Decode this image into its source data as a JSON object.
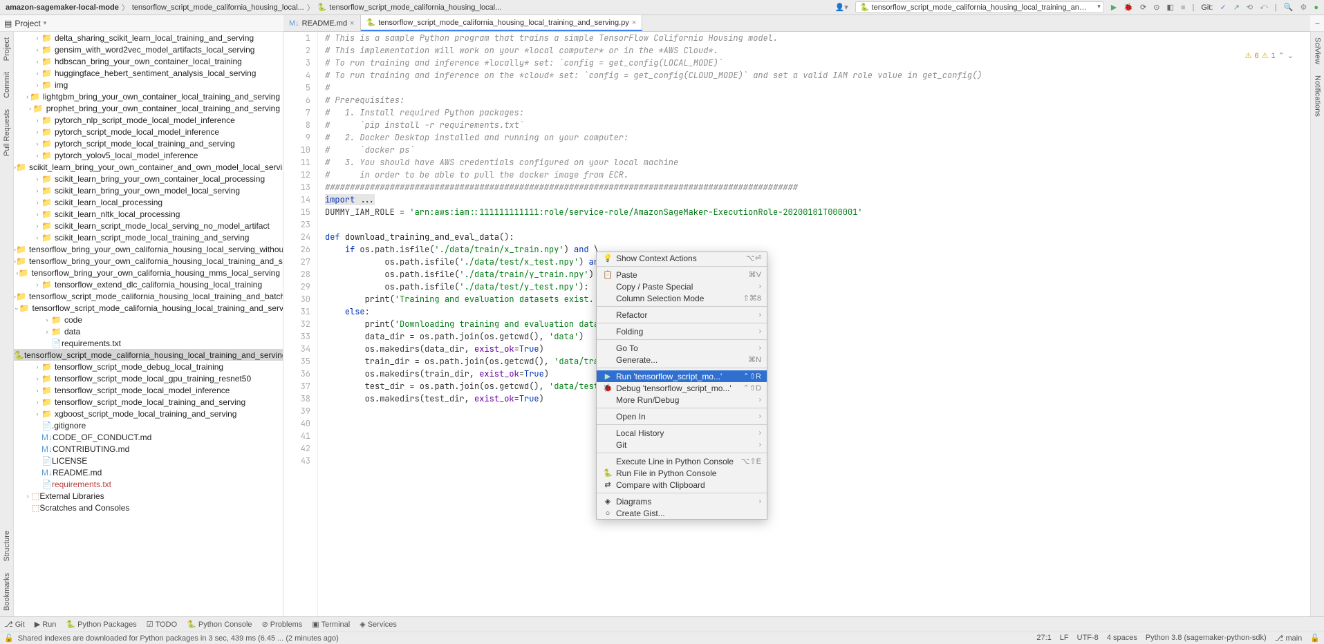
{
  "breadcrumbs": {
    "p0": "amazon-sagemaker-local-mode",
    "p1": "tensorflow_script_mode_california_housing_local...",
    "p2": "tensorflow_script_mode_california_housing_local...",
    "run_config": "tensorflow_script_mode_california_housing_local_training_and_serving",
    "git_label": "Git:"
  },
  "toolbar": {
    "project_label": "Project"
  },
  "left_tools": [
    "Project",
    "Commit",
    "Pull Requests",
    "Structure",
    "Bookmarks"
  ],
  "right_tools": [
    "SciView",
    "Notifications"
  ],
  "tree": [
    {
      "ind": 2,
      "arrow": "›",
      "kind": "folder",
      "label": "delta_sharing_scikit_learn_local_training_and_serving"
    },
    {
      "ind": 2,
      "arrow": "›",
      "kind": "folder",
      "label": "gensim_with_word2vec_model_artifacts_local_serving"
    },
    {
      "ind": 2,
      "arrow": "›",
      "kind": "folder",
      "label": "hdbscan_bring_your_own_container_local_training"
    },
    {
      "ind": 2,
      "arrow": "›",
      "kind": "folder",
      "label": "huggingface_hebert_sentiment_analysis_local_serving"
    },
    {
      "ind": 2,
      "arrow": "›",
      "kind": "folder",
      "label": "img"
    },
    {
      "ind": 2,
      "arrow": "›",
      "kind": "folder",
      "label": "lightgbm_bring_your_own_container_local_training_and_serving"
    },
    {
      "ind": 2,
      "arrow": "›",
      "kind": "folder",
      "label": "prophet_bring_your_own_container_local_training_and_serving"
    },
    {
      "ind": 2,
      "arrow": "›",
      "kind": "folder",
      "label": "pytorch_nlp_script_mode_local_model_inference"
    },
    {
      "ind": 2,
      "arrow": "›",
      "kind": "folder",
      "label": "pytorch_script_mode_local_model_inference"
    },
    {
      "ind": 2,
      "arrow": "›",
      "kind": "folder",
      "label": "pytorch_script_mode_local_training_and_serving"
    },
    {
      "ind": 2,
      "arrow": "›",
      "kind": "folder",
      "label": "pytorch_yolov5_local_model_inference"
    },
    {
      "ind": 2,
      "arrow": "›",
      "kind": "folder",
      "label": "scikit_learn_bring_your_own_container_and_own_model_local_serving"
    },
    {
      "ind": 2,
      "arrow": "›",
      "kind": "folder",
      "label": "scikit_learn_bring_your_own_container_local_processing"
    },
    {
      "ind": 2,
      "arrow": "›",
      "kind": "folder",
      "label": "scikit_learn_bring_your_own_model_local_serving"
    },
    {
      "ind": 2,
      "arrow": "›",
      "kind": "folder",
      "label": "scikit_learn_local_processing"
    },
    {
      "ind": 2,
      "arrow": "›",
      "kind": "folder",
      "label": "scikit_learn_nltk_local_processing"
    },
    {
      "ind": 2,
      "arrow": "›",
      "kind": "folder",
      "label": "scikit_learn_script_mode_local_serving_no_model_artifact"
    },
    {
      "ind": 2,
      "arrow": "›",
      "kind": "folder",
      "label": "scikit_learn_script_mode_local_training_and_serving"
    },
    {
      "ind": 2,
      "arrow": "›",
      "kind": "folder",
      "label": "tensorflow_bring_your_own_california_housing_local_serving_without_tfs"
    },
    {
      "ind": 2,
      "arrow": "›",
      "kind": "folder",
      "label": "tensorflow_bring_your_own_california_housing_local_training_and_serving"
    },
    {
      "ind": 2,
      "arrow": "›",
      "kind": "folder",
      "label": "tensorflow_bring_your_own_california_housing_mms_local_serving"
    },
    {
      "ind": 2,
      "arrow": "›",
      "kind": "folder",
      "label": "tensorflow_extend_dlc_california_housing_local_training"
    },
    {
      "ind": 2,
      "arrow": "›",
      "kind": "folder",
      "label": "tensorflow_script_mode_california_housing_local_training_and_batch_transform"
    },
    {
      "ind": 2,
      "arrow": "⌄",
      "kind": "folder",
      "label": "tensorflow_script_mode_california_housing_local_training_and_serving"
    },
    {
      "ind": 3,
      "arrow": "›",
      "kind": "folder",
      "label": "code"
    },
    {
      "ind": 3,
      "arrow": "›",
      "kind": "folder",
      "label": "data"
    },
    {
      "ind": 3,
      "arrow": "",
      "kind": "file",
      "label": "requirements.txt"
    },
    {
      "ind": 3,
      "arrow": "",
      "kind": "pyfile",
      "label": "tensorflow_script_mode_california_housing_local_training_and_serving.py",
      "selected": true
    },
    {
      "ind": 2,
      "arrow": "›",
      "kind": "folder",
      "label": "tensorflow_script_mode_debug_local_training"
    },
    {
      "ind": 2,
      "arrow": "›",
      "kind": "folder",
      "label": "tensorflow_script_mode_local_gpu_training_resnet50"
    },
    {
      "ind": 2,
      "arrow": "›",
      "kind": "folder",
      "label": "tensorflow_script_mode_local_model_inference"
    },
    {
      "ind": 2,
      "arrow": "›",
      "kind": "folder",
      "label": "tensorflow_script_mode_local_training_and_serving"
    },
    {
      "ind": 2,
      "arrow": "›",
      "kind": "folder",
      "label": "xgboost_script_mode_local_training_and_serving"
    },
    {
      "ind": 2,
      "arrow": "",
      "kind": "file",
      "label": ".gitignore"
    },
    {
      "ind": 2,
      "arrow": "",
      "kind": "mdfile",
      "label": "CODE_OF_CONDUCT.md"
    },
    {
      "ind": 2,
      "arrow": "",
      "kind": "mdfile",
      "label": "CONTRIBUTING.md"
    },
    {
      "ind": 2,
      "arrow": "",
      "kind": "file",
      "label": "LICENSE"
    },
    {
      "ind": 2,
      "arrow": "",
      "kind": "mdfile",
      "label": "README.md"
    },
    {
      "ind": 2,
      "arrow": "",
      "kind": "file",
      "label": "requirements.txt",
      "red": true
    },
    {
      "ind": 1,
      "arrow": "›",
      "kind": "lib",
      "label": "External Libraries"
    },
    {
      "ind": 1,
      "arrow": "",
      "kind": "scratch",
      "label": "Scratches and Consoles"
    }
  ],
  "tabs": [
    {
      "icon": "md",
      "label": "README.md",
      "active": false
    },
    {
      "icon": "py",
      "label": "tensorflow_script_mode_california_housing_local_training_and_serving.py",
      "active": true
    }
  ],
  "inspections": {
    "warn_count": "6",
    "weak_count": "1"
  },
  "code": {
    "lines": [
      {
        "n": 1,
        "cls": "c-comment",
        "t": "# This is a sample Python program that trains a simple TensorFlow California Housing model."
      },
      {
        "n": 2,
        "cls": "c-comment",
        "t": "# This implementation will work on your *local computer* or in the *AWS Cloud*."
      },
      {
        "n": 3,
        "cls": "c-comment",
        "t": "# To run training and inference *locally* set: `config = get_config(LOCAL_MODE)`"
      },
      {
        "n": 4,
        "cls": "c-comment",
        "t": "# To run training and inference on the *cloud* set: `config = get_config(CLOUD_MODE)` and set a valid IAM role value in get_config()"
      },
      {
        "n": 5,
        "cls": "c-comment",
        "t": "#"
      },
      {
        "n": 6,
        "cls": "c-comment",
        "t": "# Prerequisites:"
      },
      {
        "n": 7,
        "cls": "c-comment",
        "t": "#   1. Install required Python packages:"
      },
      {
        "n": 8,
        "cls": "c-comment",
        "t": "#      `pip install -r requirements.txt`"
      },
      {
        "n": 9,
        "cls": "c-comment",
        "t": "#   2. Docker Desktop installed and running on your computer:"
      },
      {
        "n": 10,
        "cls": "c-comment",
        "t": "#      `docker ps`"
      },
      {
        "n": 11,
        "cls": "c-comment",
        "t": "#   3. You should have AWS credentials configured on your local machine"
      },
      {
        "n": 12,
        "cls": "c-comment",
        "t": "#      in order to be able to pull the docker image from ECR."
      },
      {
        "n": 13,
        "cls": "c-comment",
        "t": "###############################################################################################"
      },
      {
        "n": 14,
        "t": ""
      },
      {
        "n": 15,
        "raw": "<span class='hl-imp'><span class='c-key'>import</span> ...</span>"
      },
      {
        "n": 23,
        "t": ""
      },
      {
        "n": 24,
        "raw": "DUMMY_IAM_ROLE = <span class='c-str'>'arn:aws:iam::111111111111:role/service-role/AmazonSageMaker-ExecutionRole-20200101T000001'</span>"
      },
      {
        "n": 26,
        "t": ""
      },
      {
        "n": 27,
        "t": "",
        "hl": true
      },
      {
        "n": 28,
        "raw": "<span class='c-key'>def</span> <span style='color:#222'>download_training_and_eval_data</span>():"
      },
      {
        "n": 29,
        "raw": "    <span class='c-key'>if</span> os.path.isfile(<span class='c-str'>'./data/train/x_train.npy'</span>) <span class='c-key'>and</span> \\"
      },
      {
        "n": 30,
        "raw": "            os.path.isfile(<span class='c-str'>'./data/test/x_test.npy'</span>) <span class='c-key'>and</span> \\"
      },
      {
        "n": 31,
        "raw": "            os.path.isfile(<span class='c-str'>'./data/train/y_train.npy'</span>) <span class='c-key'>and</span> \\"
      },
      {
        "n": 32,
        "raw": "            os.path.isfile(<span class='c-str'>'./data/test/y_test.npy'</span>):"
      },
      {
        "n": 33,
        "raw": "        print(<span class='c-str'>'Training and evaluation datasets exist. Skippin</span>"
      },
      {
        "n": 34,
        "raw": "    <span class='c-key'>else</span>:"
      },
      {
        "n": 35,
        "raw": "        print(<span class='c-str'>'Downloading training and evaluation dataset'</span>)"
      },
      {
        "n": 36,
        "raw": "        data_dir = os.path.join(os.getcwd(), <span class='c-str'>'data'</span>)"
      },
      {
        "n": 37,
        "raw": "        os.makedirs(data_dir, <span style='color:#660099'>exist_ok</span>=<span class='c-key'>True</span>)"
      },
      {
        "n": 38,
        "t": ""
      },
      {
        "n": 39,
        "raw": "        train_dir = os.path.join(os.getcwd(), <span class='c-str'>'data/train'</span>)"
      },
      {
        "n": 40,
        "raw": "        os.makedirs(train_dir, <span style='color:#660099'>exist_ok</span>=<span class='c-key'>True</span>)"
      },
      {
        "n": 41,
        "t": ""
      },
      {
        "n": 42,
        "raw": "        test_dir = os.path.join(os.getcwd(), <span class='c-str'>'data/test'</span>)"
      },
      {
        "n": 43,
        "raw": "        os.makedirs(test_dir, <span style='color:#660099'>exist_ok</span>=<span class='c-key'>True</span>)"
      }
    ]
  },
  "context_menu": [
    {
      "icon": "💡",
      "label": "Show Context Actions",
      "kb": "⌥⏎"
    },
    {
      "sep": true
    },
    {
      "icon": "📋",
      "label": "Paste",
      "kb": "⌘V"
    },
    {
      "label": "Copy / Paste Special",
      "sub": "›"
    },
    {
      "label": "Column Selection Mode",
      "kb": "⇧⌘8"
    },
    {
      "sep": true
    },
    {
      "label": "Refactor",
      "sub": "›"
    },
    {
      "sep": true
    },
    {
      "label": "Folding",
      "sub": "›"
    },
    {
      "sep": true
    },
    {
      "label": "Go To",
      "sub": "›"
    },
    {
      "label": "Generate...",
      "kb": "⌘N"
    },
    {
      "sep": true
    },
    {
      "icon": "▶",
      "label": "Run 'tensorflow_script_mo...'",
      "kb": "⌃⇧R",
      "hover": true,
      "green": true
    },
    {
      "icon": "🐞",
      "label": "Debug 'tensorflow_script_mo...'",
      "kb": "⌃⇧D"
    },
    {
      "label": "More Run/Debug",
      "sub": "›"
    },
    {
      "sep": true
    },
    {
      "label": "Open In",
      "sub": "›"
    },
    {
      "sep": true
    },
    {
      "label": "Local History",
      "sub": "›"
    },
    {
      "label": "Git",
      "sub": "›"
    },
    {
      "sep": true
    },
    {
      "label": "Execute Line in Python Console",
      "kb": "⌥⇧E"
    },
    {
      "icon": "🐍",
      "label": "Run File in Python Console"
    },
    {
      "icon": "⇄",
      "label": "Compare with Clipboard"
    },
    {
      "sep": true
    },
    {
      "icon": "◈",
      "label": "Diagrams",
      "sub": "›"
    },
    {
      "icon": "○",
      "label": "Create Gist..."
    }
  ],
  "bottom_tools": {
    "git": "Git",
    "run": "Run",
    "pypkg": "Python Packages",
    "todo": "TODO",
    "pycon": "Python Console",
    "problems": "Problems",
    "terminal": "Terminal",
    "services": "Services"
  },
  "statusbar": {
    "msg": "Shared indexes are downloaded for Python packages in 3 sec, 439 ms (6.45 ... (2 minutes ago)",
    "pos": "27:1",
    "lf": "LF",
    "enc": "UTF-8",
    "indent": "4 spaces",
    "interp": "Python 3.8 (sagemaker-python-sdk)",
    "branch": "main"
  }
}
